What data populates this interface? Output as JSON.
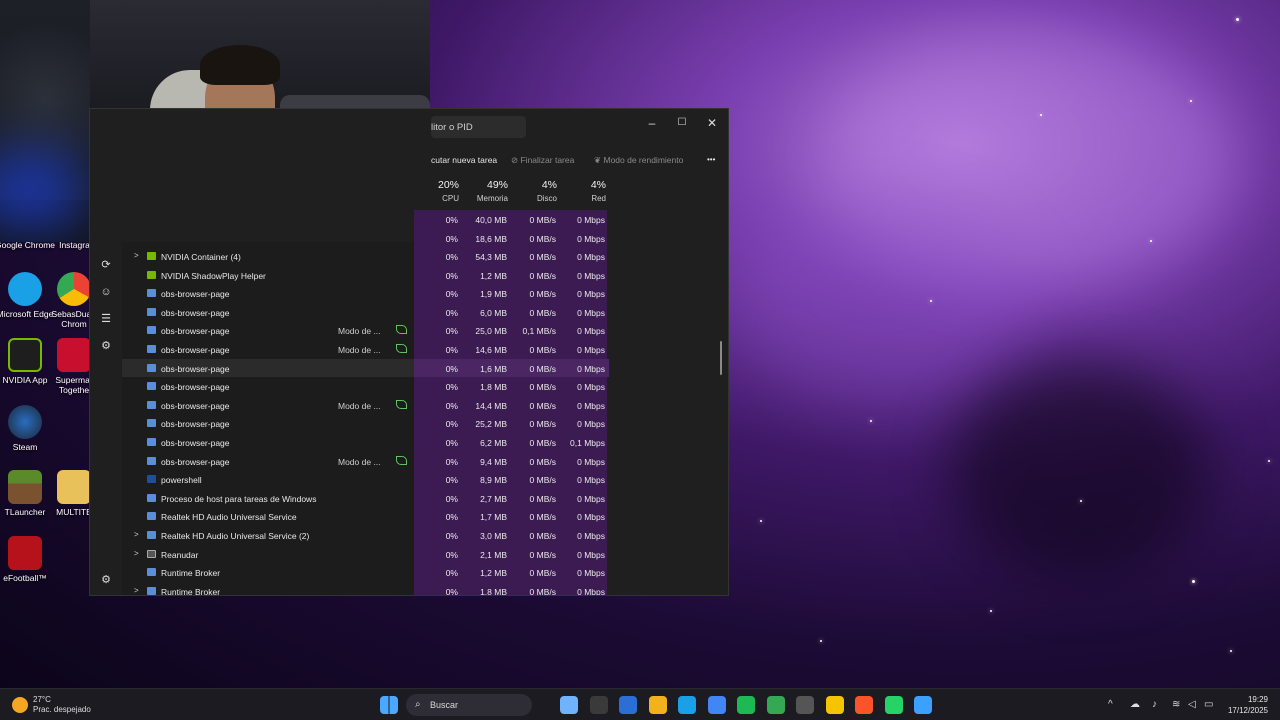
{
  "taskmgr": {
    "search_text": "litor o PID",
    "window_buttons": [
      "–",
      "☐",
      "✕"
    ],
    "toolbar": {
      "run_new_task": "cutar nueva tarea",
      "end_task": "Finalizar tarea",
      "efficiency_mode": "Modo de rendimiento",
      "more": "•••"
    },
    "headers": [
      {
        "pct": "20%",
        "label": "CPU"
      },
      {
        "pct": "49%",
        "label": "Memoria"
      },
      {
        "pct": "4%",
        "label": "Disco"
      },
      {
        "pct": "4%",
        "label": "Red"
      }
    ],
    "top_rows": [
      {
        "cpu": "0%",
        "mem": "40,0 MB",
        "disk": "0 MB/s",
        "net": "0 Mbps"
      },
      {
        "cpu": "0%",
        "mem": "18,6 MB",
        "disk": "0 MB/s",
        "net": "0 Mbps"
      }
    ],
    "rows": [
      {
        "name": "NVIDIA Container (4)",
        "expand": true,
        "icon": "nv",
        "status": "",
        "cpu": "0%",
        "mem": "54,3 MB",
        "disk": "0 MB/s",
        "net": "0 Mbps"
      },
      {
        "name": "NVIDIA ShadowPlay Helper",
        "expand": false,
        "icon": "nv",
        "status": "",
        "cpu": "0%",
        "mem": "1,2 MB",
        "disk": "0 MB/s",
        "net": "0 Mbps"
      },
      {
        "name": "obs-browser-page",
        "expand": false,
        "icon": "app",
        "status": "",
        "cpu": "0%",
        "mem": "1,9 MB",
        "disk": "0 MB/s",
        "net": "0 Mbps"
      },
      {
        "name": "obs-browser-page",
        "expand": false,
        "icon": "app",
        "status": "",
        "cpu": "0%",
        "mem": "6,0 MB",
        "disk": "0 MB/s",
        "net": "0 Mbps"
      },
      {
        "name": "obs-browser-page",
        "expand": false,
        "icon": "app",
        "status": "Modo de ...",
        "cpu": "0%",
        "mem": "25,0 MB",
        "disk": "0,1 MB/s",
        "net": "0 Mbps"
      },
      {
        "name": "obs-browser-page",
        "expand": false,
        "icon": "app",
        "status": "Modo de ...",
        "cpu": "0%",
        "mem": "14,6 MB",
        "disk": "0 MB/s",
        "net": "0 Mbps"
      },
      {
        "name": "obs-browser-page",
        "expand": false,
        "icon": "app",
        "status": "",
        "cpu": "0%",
        "mem": "1,6 MB",
        "disk": "0 MB/s",
        "net": "0 Mbps",
        "highlight": true
      },
      {
        "name": "obs-browser-page",
        "expand": false,
        "icon": "app",
        "status": "",
        "cpu": "0%",
        "mem": "1,8 MB",
        "disk": "0 MB/s",
        "net": "0 Mbps"
      },
      {
        "name": "obs-browser-page",
        "expand": false,
        "icon": "app",
        "status": "Modo de ...",
        "cpu": "0%",
        "mem": "14,4 MB",
        "disk": "0 MB/s",
        "net": "0 Mbps"
      },
      {
        "name": "obs-browser-page",
        "expand": false,
        "icon": "app",
        "status": "",
        "cpu": "0%",
        "mem": "25,2 MB",
        "disk": "0 MB/s",
        "net": "0 Mbps"
      },
      {
        "name": "obs-browser-page",
        "expand": false,
        "icon": "app",
        "status": "",
        "cpu": "0%",
        "mem": "6,2 MB",
        "disk": "0 MB/s",
        "net": "0,1 Mbps"
      },
      {
        "name": "obs-browser-page",
        "expand": false,
        "icon": "app",
        "status": "Modo de ...",
        "cpu": "0%",
        "mem": "9,4 MB",
        "disk": "0 MB/s",
        "net": "0 Mbps"
      },
      {
        "name": "powershell",
        "expand": false,
        "icon": "ps",
        "status": "",
        "cpu": "0%",
        "mem": "8,9 MB",
        "disk": "0 MB/s",
        "net": "0 Mbps"
      },
      {
        "name": "Proceso de host para tareas de Windows",
        "expand": false,
        "icon": "app",
        "status": "",
        "cpu": "0%",
        "mem": "2,7 MB",
        "disk": "0 MB/s",
        "net": "0 Mbps"
      },
      {
        "name": "Realtek HD Audio Universal Service",
        "expand": false,
        "icon": "app",
        "status": "",
        "cpu": "0%",
        "mem": "1,7 MB",
        "disk": "0 MB/s",
        "net": "0 Mbps"
      },
      {
        "name": "Realtek HD Audio Universal Service (2)",
        "expand": true,
        "icon": "app",
        "status": "",
        "cpu": "0%",
        "mem": "3,0 MB",
        "disk": "0 MB/s",
        "net": "0 Mbps"
      },
      {
        "name": "Reanudar",
        "expand": true,
        "icon": "gr",
        "status": "",
        "cpu": "0%",
        "mem": "2,1 MB",
        "disk": "0 MB/s",
        "net": "0 Mbps"
      },
      {
        "name": "Runtime Broker",
        "expand": false,
        "icon": "app",
        "status": "",
        "cpu": "0%",
        "mem": "1,2 MB",
        "disk": "0 MB/s",
        "net": "0 Mbps"
      },
      {
        "name": "Runtime Broker",
        "expand": true,
        "icon": "app",
        "status": "",
        "cpu": "0%",
        "mem": "1,8 MB",
        "disk": "0 MB/s",
        "net": "0 Mbps"
      }
    ]
  },
  "desktop_icons": [
    {
      "label": "Google Chrome",
      "color": "#4285f4"
    },
    {
      "label": "Instagram",
      "color": "#d62976"
    },
    {
      "label": "Microsoft Edge",
      "color": "#1aa0e6"
    },
    {
      "label": "SebasDua - Chrom",
      "color": "#34a853"
    },
    {
      "label": "NVIDIA App",
      "color": "#76b900"
    },
    {
      "label": "Supermar Togethe",
      "color": "#c8102e"
    },
    {
      "label": "Steam",
      "color": "#1b2838"
    },
    {
      "label": "TLauncher",
      "color": "#5a8a2a"
    },
    {
      "label": "MULTITE",
      "color": "#e8c15a"
    },
    {
      "label": "eFootball™",
      "color": "#b5121b"
    }
  ],
  "taskbar": {
    "weather_temp": "27°C",
    "weather_desc": "Prac. despejado",
    "search_label": "Buscar",
    "time": "19:29",
    "date": "17/12/2025",
    "apps": [
      "#6fb3ff",
      "#3a3a3a",
      "#2b6fd6",
      "#f2b21b",
      "#1aa0e6",
      "#4285f4",
      "#1db954",
      "#34a853",
      "#555",
      "#f5c400",
      "#fb542b",
      "#25d366",
      "#3ba0ff"
    ]
  }
}
